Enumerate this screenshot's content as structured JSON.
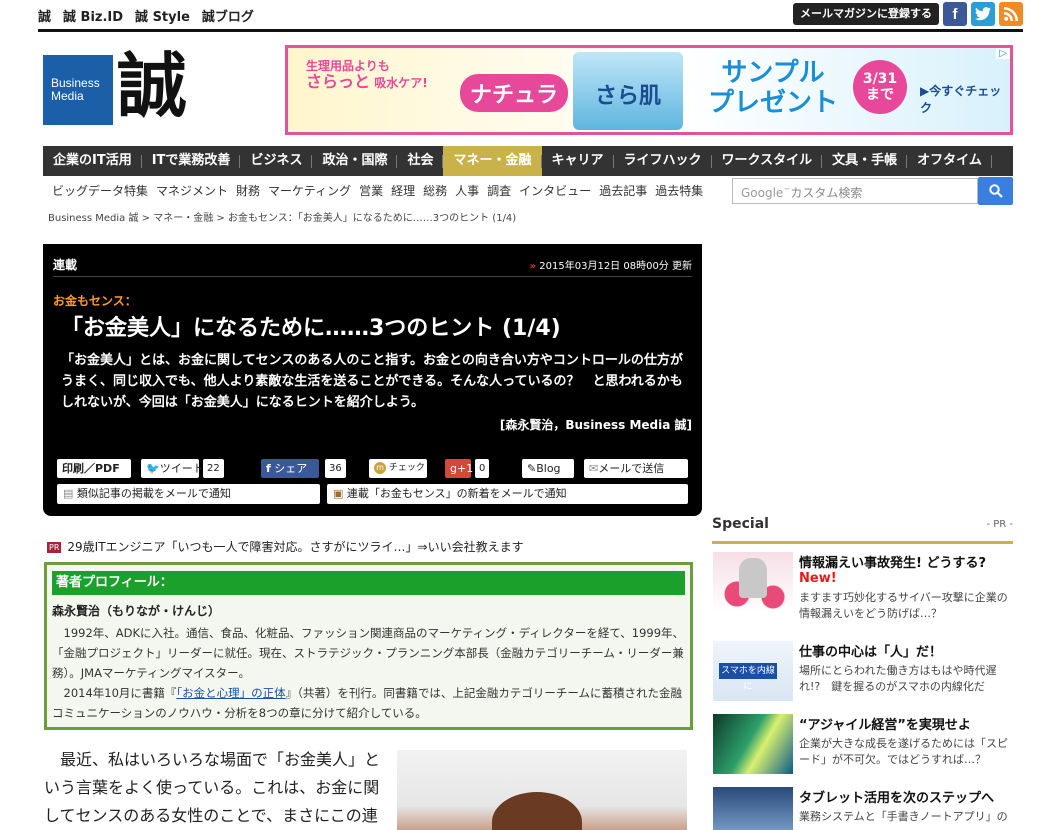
{
  "topnav": [
    "誠",
    "誠 Biz.ID",
    "誠 Style",
    "誠ブログ"
  ],
  "mailmag_button": "メールマガジンに登録する",
  "logo": {
    "line1": "Business",
    "line2": "Media",
    "kanji": "誠"
  },
  "banner": {
    "text1": "生理用品よりも",
    "text2": "さらっと",
    "text3": "吸水ケア!",
    "brand": "ナチュラ",
    "product": "さら肌",
    "sample": "サンプル",
    "present": "プレゼント",
    "date1": "3/31",
    "date2": "まで",
    "cta": "▶今すぐチェック"
  },
  "mainnav": [
    "企業のIT活用",
    "ITで業務改善",
    "ビジネス",
    "政治・国際",
    "社会",
    "マネー・金融",
    "キャリア",
    "ライフハック",
    "ワークスタイル",
    "文具・手帳",
    "オフタイム"
  ],
  "mainnav_active": "マネー・金融",
  "subnav": [
    "ビッグデータ特集",
    "マネジメント",
    "財務",
    "マーケティング",
    "営業",
    "経理",
    "総務",
    "人事",
    "調査",
    "インタビュー",
    "過去記事",
    "過去特集"
  ],
  "search": {
    "brand": "Google",
    "placeholder": "カスタム検索"
  },
  "breadcrumb": "Business Media 誠 > マネー・金融 > お金もセンス：「お金美人」になるために……3つのヒント (1/4)",
  "article": {
    "series_label": "連載",
    "date": "2015年03月12日 08時00分 更新",
    "kicker": "お金もセンス：",
    "title": "「お金美人」になるために……3つのヒント (1/4)",
    "lead": "「お金美人」とは、お金に関してセンスのある人のこと指す。お金との向き合い方やコントロールの仕方がうまく、同じ収入でも、他人より素敵な生活を送ることができる。そんな人っているの？　と思われるかもしれないが、今回は「お金美人」になるヒントを紹介しよう。",
    "byline": "[森永賢治，Business Media 誠]"
  },
  "share": {
    "print": "印刷／PDF",
    "tweet": "ツイート",
    "tweet_count": "22",
    "fb_share": "シェア",
    "fb_count": "36",
    "check": "チェック",
    "gplus": "g+1",
    "gplus_count": "0",
    "blog": "Blog",
    "mail": "メールで送信",
    "similar_mail": "類似記事の掲載をメールで通知",
    "series_mail": "連載「お金もセンス」の新着をメールで通知"
  },
  "special": {
    "heading": "Special",
    "pr": "- PR -",
    "items": [
      {
        "title": "情報漏えい事故発生! どうする?",
        "new": "New!",
        "desc": "ますます巧妙化するサイバー攻撃に企業の情報漏えいをどう防げば…？"
      },
      {
        "title": "仕事の中心は「人」だ！",
        "thumb_text": "スマホを内線に",
        "desc": "場所にとらわれた働き方はもはや時代遅れ!?　鍵を握るのがスマホの内線化だ"
      },
      {
        "title": "“アジャイル経営”を実現せよ",
        "desc": "企業が大きな成長を遂げるためには「スピード」が不可欠。ではどうすれば…？"
      },
      {
        "title": "タブレット活用を次のステップへ",
        "desc": "業務システムと「手書きノートアプリ」の"
      }
    ]
  },
  "pr_line": {
    "badge": "PR",
    "text": "29歳ITエンジニア「いつも一人で障害対応。さすがにツライ…」⇒いい会社教えます"
  },
  "profile": {
    "heading": "著者プロフィール：",
    "name": "森永賢治（もりなが・けんじ）",
    "text1": "1992年、ADKに入社。通信、食品、化粧品、ファッション関連商品のマーケティング・ディレクターを経て、1999年、「金融プロジェクト」リーダーに就任。現在、ストラテジック・プランニング本部長（金融カテゴリーチーム・リーダー兼務）。JMAマーケティングマイスター。",
    "text2_pre": "2014年10月に書籍『",
    "text2_link": "「お金と心理」の正体",
    "text2_post": "』（共著）を刊行。同書籍では、上記金融カテゴリーチームに蓄積された金融コミュニケーションのノウハウ・分析を8つの章に分けて紹介している。"
  },
  "body_text": "最近、私はいろいろな場面で「お金美人」という言葉をよく使っている。これは、お金に関してセンスのある女性のことで、まさにこの連"
}
